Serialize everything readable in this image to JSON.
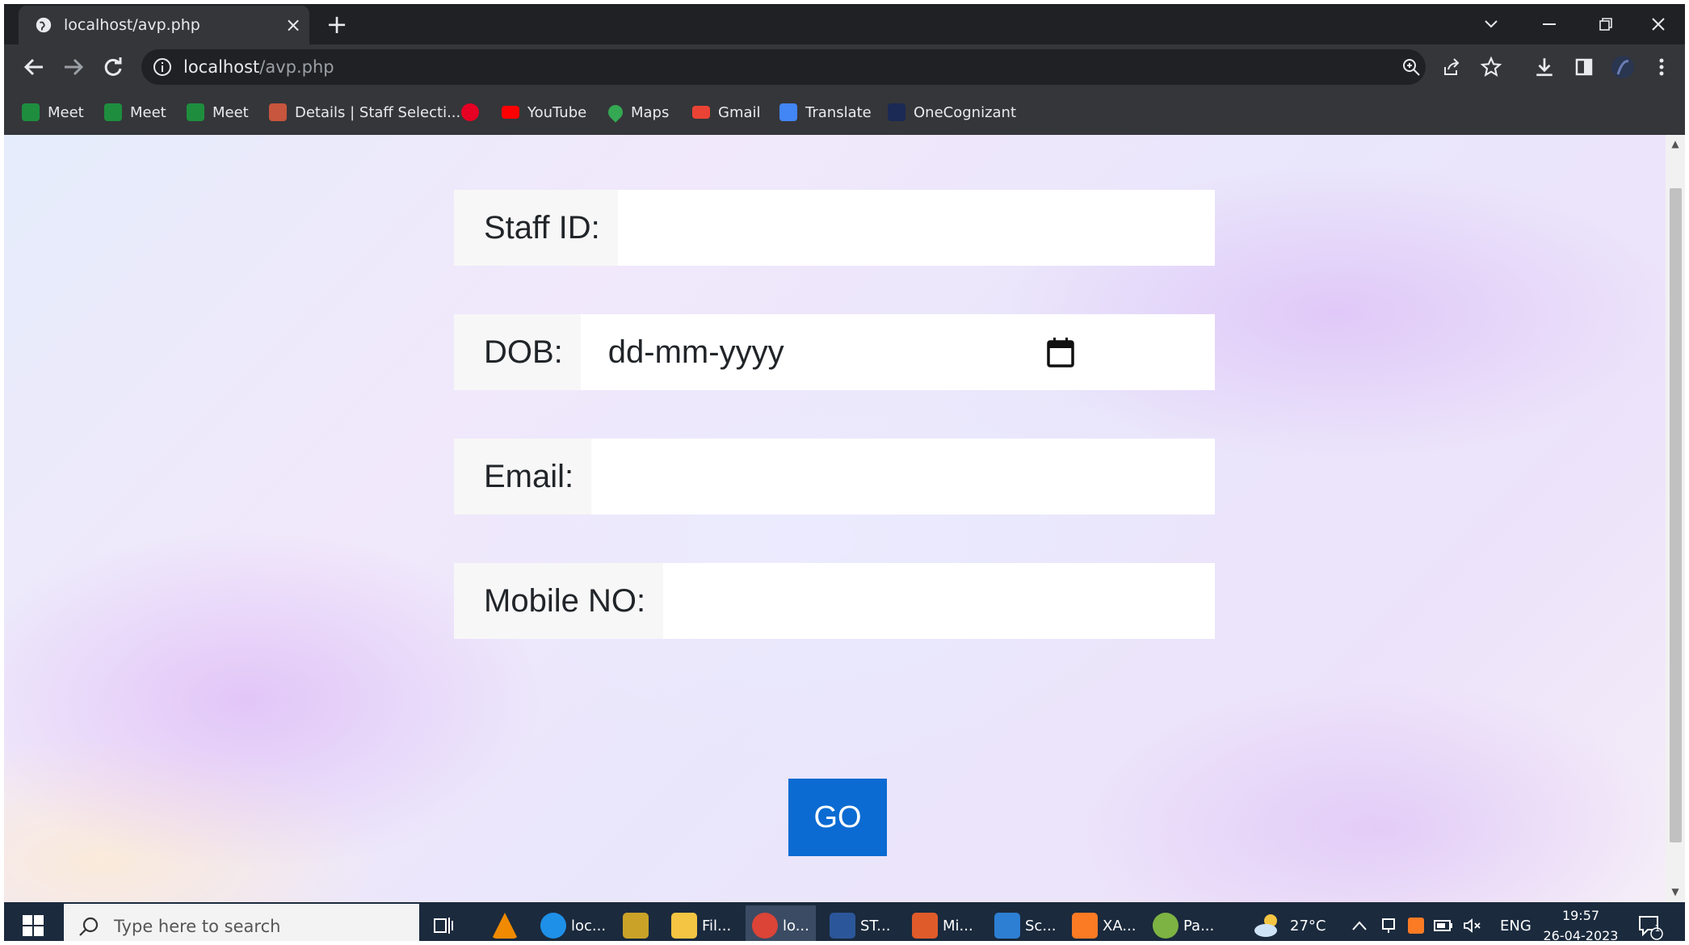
{
  "browser": {
    "tab_title": "localhost/avp.php",
    "tab_close": "×",
    "new_tab": "+",
    "url_host": "localhost",
    "url_path": "/avp.php",
    "bookmarks": [
      {
        "label": "Meet",
        "color": "#1e8e3e"
      },
      {
        "label": "Meet",
        "color": "#1e8e3e"
      },
      {
        "label": "Meet",
        "color": "#1e8e3e"
      },
      {
        "label": "Details | Staff Selecti...",
        "color": "#c8553d"
      },
      {
        "label": "",
        "color": "#e60023"
      },
      {
        "label": "YouTube",
        "color": "#ff0000"
      },
      {
        "label": "Maps",
        "color": "#34a853"
      },
      {
        "label": "Gmail",
        "color": "#ea4335"
      },
      {
        "label": "Translate",
        "color": "#4285f4"
      },
      {
        "label": "OneCognizant",
        "color": "#1a2a55"
      }
    ]
  },
  "form": {
    "staff_id_label": "Staff ID:",
    "staff_id_value": "",
    "dob_label": "DOB:",
    "dob_placeholder": "dd-mm-yyyy",
    "email_label": "Email:",
    "email_value": "",
    "mobile_label": "Mobile NO:",
    "mobile_value": "",
    "submit_label": "GO"
  },
  "taskbar": {
    "search_placeholder": "Type here to search",
    "apps": [
      {
        "label": "",
        "color": "#f08a00"
      },
      {
        "label": "loc...",
        "color": "#1e90e8"
      },
      {
        "label": "",
        "color": "#c9a227"
      },
      {
        "label": "Fil...",
        "color": "#f4c542"
      },
      {
        "label": "lo...",
        "color": "#db4437"
      },
      {
        "label": "ST...",
        "color": "#2b579a"
      },
      {
        "label": "Mi...",
        "color": "#e05b2a"
      },
      {
        "label": "Sc...",
        "color": "#2d7fd3"
      },
      {
        "label": "XA...",
        "color": "#fb7a24"
      },
      {
        "label": "Pa...",
        "color": "#7cb342"
      }
    ],
    "weather": "27°C",
    "language": "ENG",
    "time": "19:57",
    "date": "26-04-2023",
    "notification_count": "1"
  }
}
